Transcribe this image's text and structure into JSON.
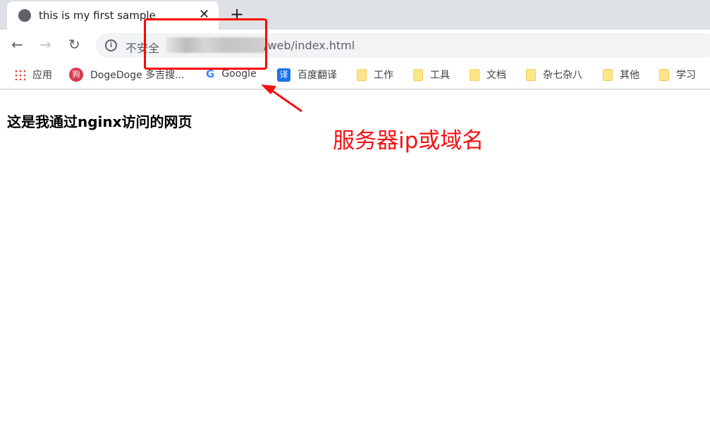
{
  "tab": {
    "title": "this is my first sample",
    "icon": "globe-icon"
  },
  "toolbar": {
    "security_label": "不安全",
    "url_visible": "/web/index.html"
  },
  "bookmarks": [
    {
      "label": "应用",
      "icon": "apps-icon"
    },
    {
      "label": "DogeDoge 多吉搜...",
      "icon": "dogedoge-icon",
      "icon_text": "狗"
    },
    {
      "label": "Google",
      "icon": "google-icon",
      "icon_text": "G"
    },
    {
      "label": "百度翻译",
      "icon": "baidu-translate-icon",
      "icon_text": "译"
    },
    {
      "label": "工作",
      "icon": "folder-icon"
    },
    {
      "label": "工具",
      "icon": "folder-icon"
    },
    {
      "label": "文档",
      "icon": "folder-icon"
    },
    {
      "label": "杂七杂八",
      "icon": "folder-icon"
    },
    {
      "label": "其他",
      "icon": "folder-icon"
    },
    {
      "label": "学习",
      "icon": "folder-icon"
    }
  ],
  "page": {
    "heading": "这是我通过nginx访问的网页"
  },
  "annotation": {
    "text": "服务器ip或域名",
    "color": "#f31212"
  }
}
